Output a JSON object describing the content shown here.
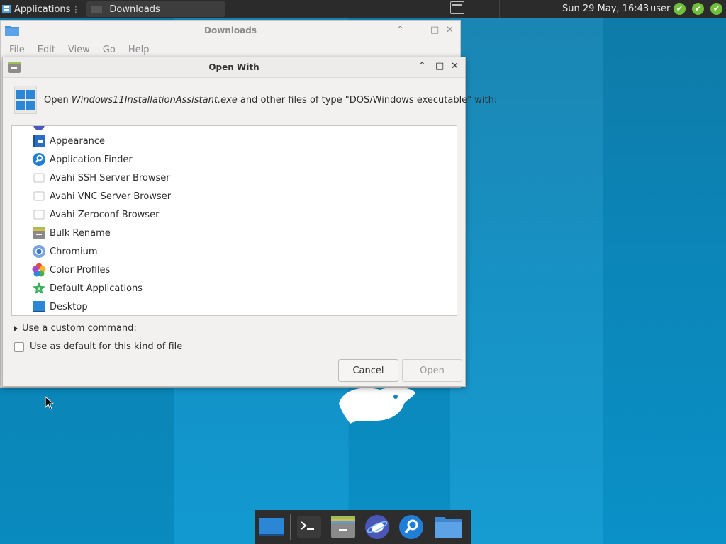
{
  "top_panel": {
    "applications_label": "Applications",
    "task_label": "Downloads",
    "clock": "Sun 29 May, 16:43",
    "user": "user",
    "tray_checks": [
      "✔",
      "✔",
      "✔"
    ]
  },
  "downloads_window": {
    "title": "Downloads",
    "menu": [
      "File",
      "Edit",
      "View",
      "Go",
      "Help"
    ]
  },
  "dialog": {
    "title": "Open With",
    "header_prefix": "Open ",
    "file_name": "Windows11InstallationAssistant.exe",
    "header_suffix": " and other files of type \"DOS/Windows executable\" with:",
    "apps": [
      {
        "label": "Appearance",
        "icon": "appearance-icon"
      },
      {
        "label": "Application Finder",
        "icon": "application-finder-icon"
      },
      {
        "label": "Avahi SSH Server Browser",
        "icon": "avahi-icon"
      },
      {
        "label": "Avahi VNC Server Browser",
        "icon": "avahi-icon"
      },
      {
        "label": "Avahi Zeroconf Browser",
        "icon": "avahi-icon"
      },
      {
        "label": "Bulk Rename",
        "icon": "bulk-rename-icon"
      },
      {
        "label": "Chromium",
        "icon": "chromium-icon"
      },
      {
        "label": "Color Profiles",
        "icon": "color-profiles-icon"
      },
      {
        "label": "Default Applications",
        "icon": "default-applications-icon"
      },
      {
        "label": "Desktop",
        "icon": "desktop-icon"
      }
    ],
    "custom_command_label": "Use a custom command:",
    "default_label": "Use as default for this kind of file",
    "default_checked": false,
    "cancel_label": "Cancel",
    "open_label": "Open"
  },
  "colors": {
    "accent_blue": "#2b87d6",
    "desktop": "#0a84b8",
    "panel": "#2b2b2b"
  }
}
